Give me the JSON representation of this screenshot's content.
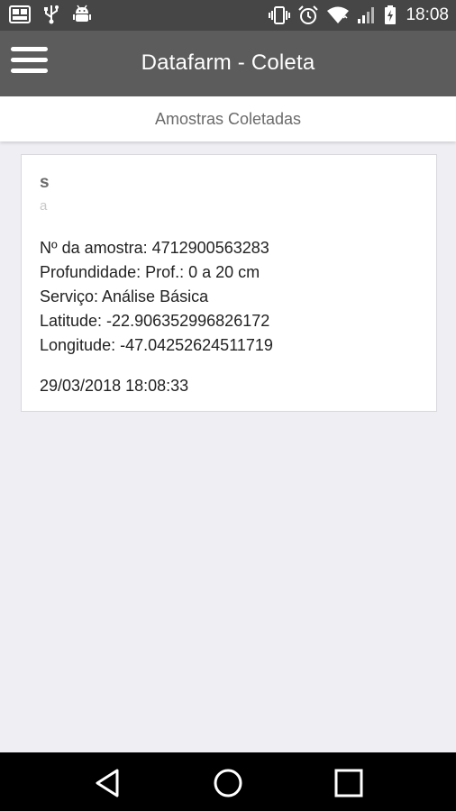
{
  "status_bar": {
    "time": "18:08"
  },
  "app_bar": {
    "title": "Datafarm - Coleta"
  },
  "sub_header": {
    "title": "Amostras Coletadas"
  },
  "card": {
    "title": "s",
    "subtitle": "a",
    "lines": [
      "Nº da amostra: 4712900563283",
      "Profundidade: Prof.: 0 a 20 cm",
      "Serviço: Análise Básica",
      "Latitude: -22.906352996826172",
      "Longitude: -47.04252624511719"
    ],
    "date": "29/03/2018 18:08:33"
  },
  "colors": {
    "status_bar": "#464646",
    "app_bar": "#5c5c5c",
    "background": "#eeeef3",
    "nav_bar": "#000000"
  }
}
